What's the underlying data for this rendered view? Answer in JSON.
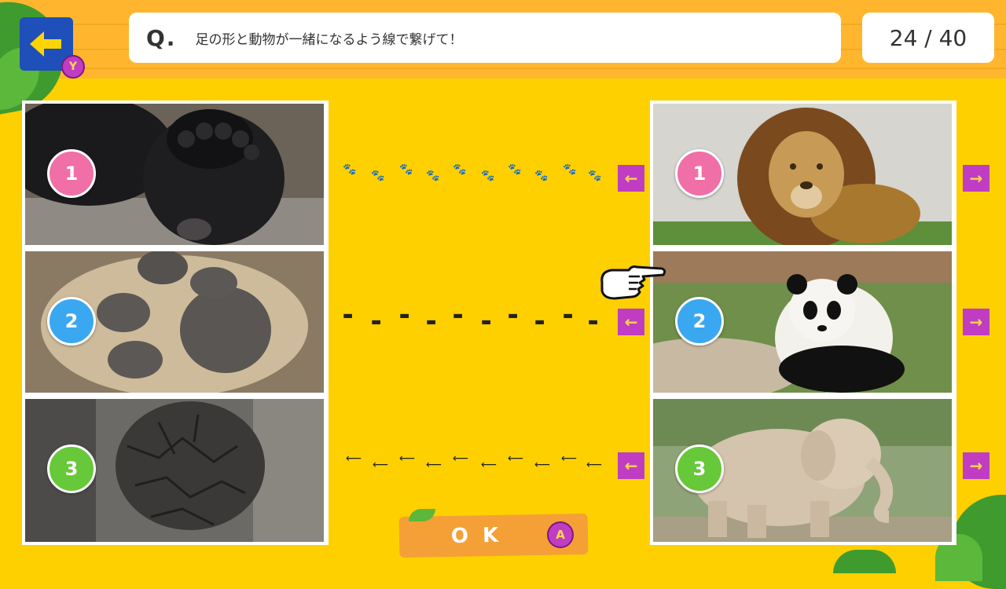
{
  "header": {
    "back_button_badge": "Y",
    "question_mark": "Q.",
    "question_text": "足の形と動物が一緒になるよう線で繋げて！",
    "progress": "24 / 40"
  },
  "left_panel": {
    "items": [
      {
        "number": "1",
        "image": "bear-paw-photo"
      },
      {
        "number": "2",
        "image": "lion-paw-photo"
      },
      {
        "number": "3",
        "image": "elephant-foot-photo"
      }
    ]
  },
  "right_panel": {
    "items": [
      {
        "number": "1",
        "image": "lion-photo"
      },
      {
        "number": "2",
        "image": "panda-photo"
      },
      {
        "number": "3",
        "image": "elephant-photo"
      }
    ]
  },
  "connectors": {
    "left_arrow": "←",
    "right_arrow": "→"
  },
  "trails": {
    "row1": "paw-prints",
    "row2": "hoof-prints",
    "row3": "bird-prints"
  },
  "footer": {
    "ok_label": "OK",
    "ok_badge": "A"
  },
  "colors": {
    "background": "#ffd000",
    "wood": "#ffb62e",
    "number1": "#f06fa6",
    "number2": "#3aa8f0",
    "number3": "#67c83a",
    "arrow": "#c03dc3",
    "back_button": "#1f4fb8"
  }
}
